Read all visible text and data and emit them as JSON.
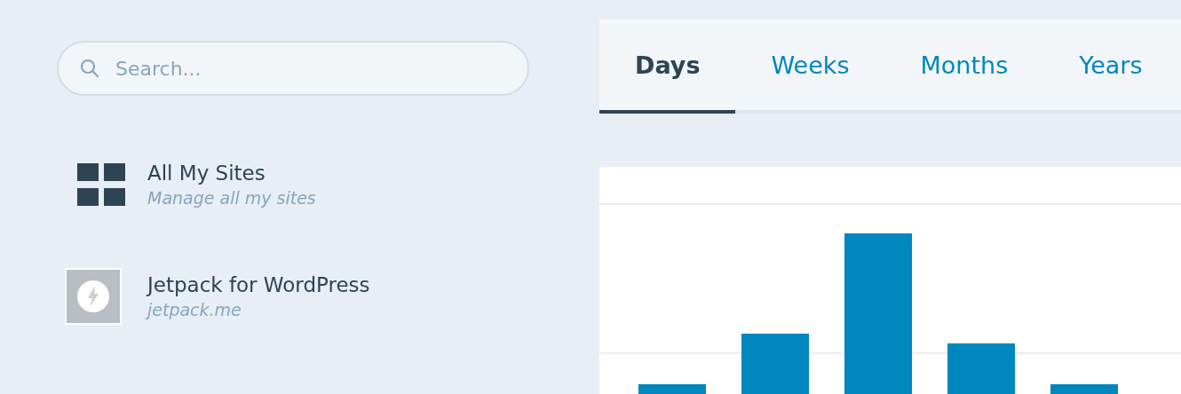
{
  "search": {
    "placeholder": "Search..."
  },
  "sites": [
    {
      "kind": "all",
      "title": "All My Sites",
      "subtitle": "Manage all my sites"
    },
    {
      "kind": "site",
      "title": "Jetpack for WordPress",
      "subtitle": "jetpack.me"
    }
  ],
  "tabs": [
    {
      "label": "Days",
      "selected": true
    },
    {
      "label": "Weeks",
      "selected": false
    },
    {
      "label": "Months",
      "selected": false
    },
    {
      "label": "Years",
      "selected": false
    }
  ]
}
